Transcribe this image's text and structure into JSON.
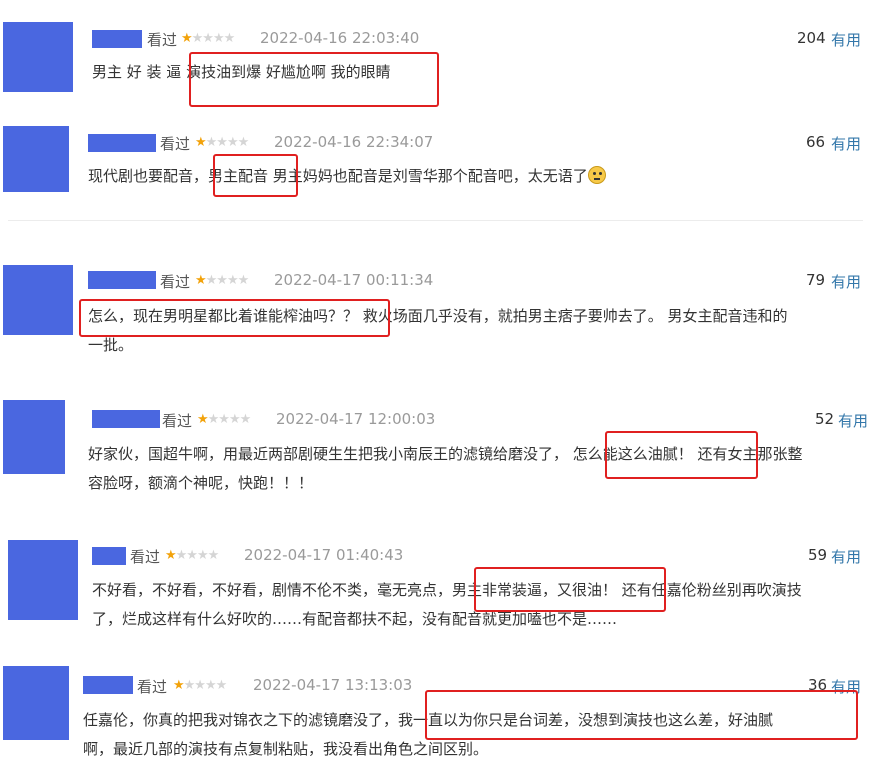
{
  "reviews": [
    {
      "watched": "看过",
      "rating": 1,
      "date": "2022-04-16 22:03:40",
      "votes": "204",
      "useful": "有用",
      "lines": [
        "男主 好 装 逼 演技油到爆 好尴尬啊 我的眼睛"
      ]
    },
    {
      "watched": "看过",
      "rating": 1,
      "date": "2022-04-16 22:34:07",
      "votes": "66",
      "useful": "有用",
      "lines": [
        "现代剧也要配音，男主配音 男主妈妈也配音是刘雪华那个配音吧，太无语了"
      ],
      "emoji": "sad-face"
    },
    {
      "watched": "看过",
      "rating": 1,
      "date": "2022-04-17 00:11:34",
      "votes": "79",
      "useful": "有用",
      "lines": [
        "怎么，现在男明星都比着谁能榨油吗？？ 救火场面几乎没有，就拍男主痞子要帅去了。 男女主配音违和的",
        "一批。"
      ]
    },
    {
      "watched": "看过",
      "rating": 1,
      "date": "2022-04-17 12:00:03",
      "votes": "52",
      "useful": "有用",
      "lines": [
        "好家伙，国超牛啊，用最近两部剧硬生生把我小南辰王的滤镜给磨没了， 怎么能这么油腻！ 还有女主那张整",
        "容脸呀，额滴个神呢，快跑！！！"
      ]
    },
    {
      "watched": "看过",
      "rating": 1,
      "date": "2022-04-17 01:40:43",
      "votes": "59",
      "useful": "有用",
      "lines": [
        "不好看，不好看，不好看，剧情不伦不类，毫无亮点，男主非常装逼，又很油！ 还有任嘉伦粉丝别再吹演技",
        "了，烂成这样有什么好吹的……有配音都扶不起，没有配音就更加嗑也不是……"
      ]
    },
    {
      "watched": "看过",
      "rating": 1,
      "date": "2022-04-17 13:13:03",
      "votes": "36",
      "useful": "有用",
      "lines": [
        "任嘉伦，你真的把我对锦衣之下的滤镜磨没了，我一直以为你只是台词差，没想到演技也这么差，好油腻",
        "啊，最近几部的演技有点复制粘贴，我没看出角色之间区别。"
      ]
    }
  ],
  "colors": {
    "accent": "#3377aa",
    "highlight_box": "#e02020",
    "avatar_placeholder": "#4a67e0",
    "star": "#f2a20a"
  }
}
